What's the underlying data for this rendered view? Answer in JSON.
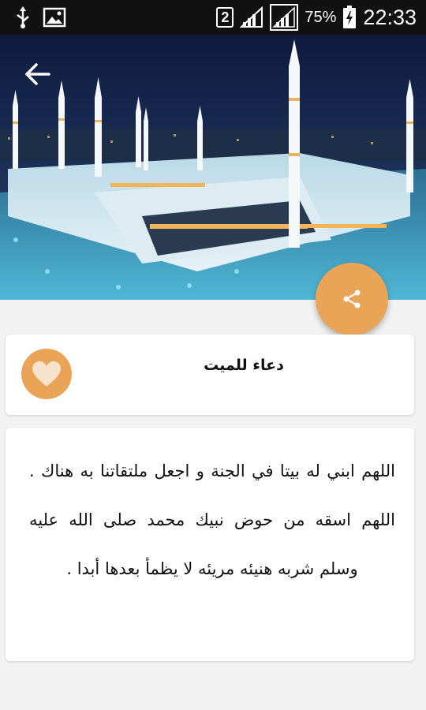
{
  "status_bar": {
    "icons": [
      "usb-icon",
      "image-icon"
    ],
    "sim_slot": "2",
    "battery_percent": "75%",
    "time": "22:33"
  },
  "hero": {
    "image": "mosque-image",
    "back_icon": "arrow-left-icon",
    "share_icon": "share-icon"
  },
  "title_card": {
    "title": "دعاء للميت",
    "favorite_icon": "heart-icon"
  },
  "body_card": {
    "text": "اللهم ابني له بيتا في الجنة و اجعل ملتقاتنا به هناك . اللهم اسقه من حوض نبيك محمد صلى الله عليه وسلم شربه هنيئه مريئه لا يظمأ بعدها أبدا ."
  },
  "colors": {
    "accent": "#e9a457",
    "status_bar": "#111111",
    "background": "#f2f2f2"
  }
}
